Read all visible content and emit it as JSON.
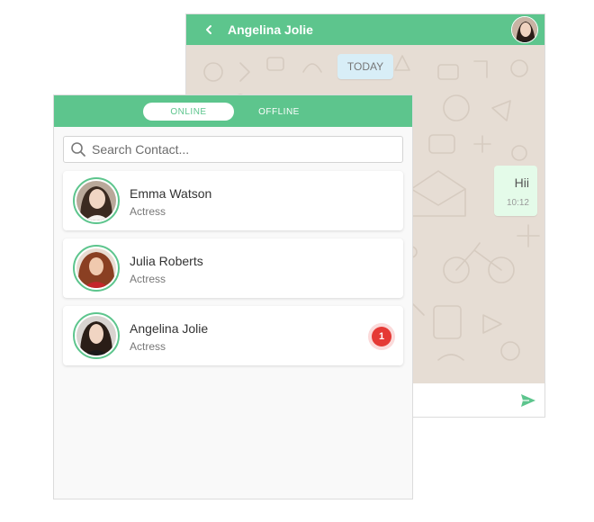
{
  "chat": {
    "contact_name": "Angelina Jolie",
    "date_chip": "TODAY",
    "message": {
      "text": "Hii",
      "time": "10:12"
    },
    "icons": {
      "back": "chevron-left-icon",
      "send": "send-icon"
    }
  },
  "contacts": {
    "tabs": {
      "online": "ONLINE",
      "offline": "OFFLINE"
    },
    "search": {
      "placeholder": "Search Contact..."
    },
    "items": [
      {
        "name": "Emma Watson",
        "role": "Actress"
      },
      {
        "name": "Julia Roberts",
        "role": "Actress"
      },
      {
        "name": "Angelina Jolie",
        "role": "Actress",
        "unread": "1"
      }
    ]
  },
  "colors": {
    "accent": "#5dc58d",
    "chat_background": "#e6ddd4",
    "date_chip": "#d8eef7",
    "outgoing_bubble": "#e4fbe9",
    "badge": "#e53935"
  }
}
